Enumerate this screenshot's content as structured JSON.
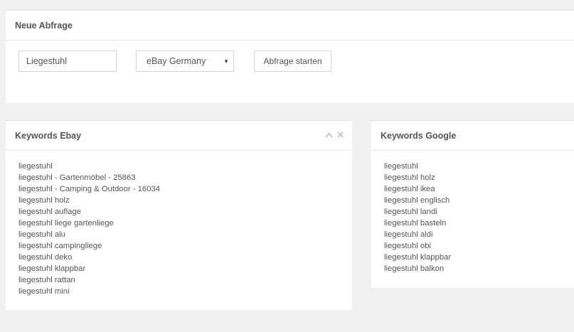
{
  "query_panel": {
    "title": "Neue Abfrage",
    "search_value": "Liegestuhl",
    "marketplace_selected": "eBay Germany",
    "submit_label": "Abfrage starten"
  },
  "ebay_panel": {
    "title": "Keywords Ebay",
    "items": [
      "liegestuhl",
      "liegestuhl - Gartenmöbel - 25863",
      "liegestuhl - Camping & Outdoor - 16034",
      "liegestuhl holz",
      "liegestuhl auflage",
      "liegestuhl liege gartenliege",
      "liegestuhl alu",
      "liegestuhl campingliege",
      "liegestuhl deko",
      "liegestuhl klappbar",
      "liegestuhl rattan",
      "liegestuhl mini"
    ]
  },
  "google_panel": {
    "title": "Keywords Google",
    "items": [
      "liegestuhl",
      "liegestuhl holz",
      "liegestuhl ikea",
      "liegestuhl englisch",
      "liegestuhl landi",
      "liegestuhl basteln",
      "liegestuhl aldi",
      "liegestuhl obi",
      "liegestuhl klappbar",
      "liegestuhl balkon"
    ]
  },
  "icons": {
    "collapse": "chevron-up-icon",
    "close": "close-icon",
    "dropdown": "caret-down-icon"
  },
  "colors": {
    "background": "#f1f1f3",
    "panel": "#ffffff",
    "text": "#555555",
    "tool_icon": "#c9c9c9"
  }
}
